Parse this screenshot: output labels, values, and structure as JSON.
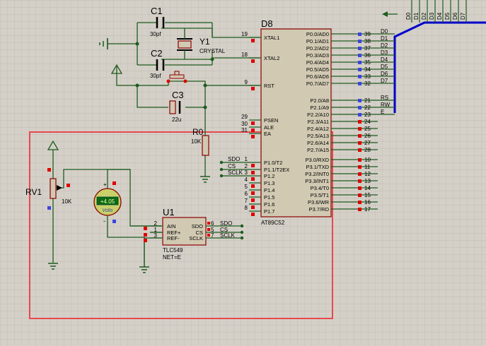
{
  "schematic": {
    "mcu": {
      "ref": "D8",
      "part": "AT89C52",
      "left_pins": [
        {
          "num": "19",
          "name": "XTAL1"
        },
        {
          "num": "18",
          "name": "XTAL2"
        },
        {
          "num": "9",
          "name": "RST"
        },
        {
          "num": "29",
          "name": "PSEN"
        },
        {
          "num": "30",
          "name": "ALE"
        },
        {
          "num": "31",
          "name": "EA"
        },
        {
          "num": "1",
          "name": "P1.0/T2"
        },
        {
          "num": "2",
          "name": "P1.1/T2EX"
        },
        {
          "num": "3",
          "name": "P1.2"
        },
        {
          "num": "4",
          "name": "P1.3"
        },
        {
          "num": "5",
          "name": "P1.4"
        },
        {
          "num": "6",
          "name": "P1.5"
        },
        {
          "num": "7",
          "name": "P1.6"
        },
        {
          "num": "8",
          "name": "P1.7"
        }
      ],
      "right_pins": [
        {
          "num": "39",
          "name": "P0.0/AD0"
        },
        {
          "num": "38",
          "name": "P0.1/AD1"
        },
        {
          "num": "37",
          "name": "P0.2/AD2"
        },
        {
          "num": "36",
          "name": "P0.3/AD3"
        },
        {
          "num": "35",
          "name": "P0.4/AD4"
        },
        {
          "num": "34",
          "name": "P0.5/AD5"
        },
        {
          "num": "33",
          "name": "P0.6/AD6"
        },
        {
          "num": "32",
          "name": "P0.7/AD7"
        },
        {
          "num": "21",
          "name": "P2.0/A8"
        },
        {
          "num": "22",
          "name": "P2.1/A9"
        },
        {
          "num": "23",
          "name": "P2.2/A10"
        },
        {
          "num": "24",
          "name": "P2.3/A11"
        },
        {
          "num": "25",
          "name": "P2.4/A12"
        },
        {
          "num": "26",
          "name": "P2.5/A13"
        },
        {
          "num": "27",
          "name": "P2.6/A14"
        },
        {
          "num": "28",
          "name": "P2.7/A15"
        },
        {
          "num": "10",
          "name": "P3.0/RXD"
        },
        {
          "num": "11",
          "name": "P3.1/TXD"
        },
        {
          "num": "12",
          "name": "P3.2/INT0"
        },
        {
          "num": "13",
          "name": "P3.3/INT1"
        },
        {
          "num": "14",
          "name": "P3.4/T0"
        },
        {
          "num": "15",
          "name": "P3.5/T1"
        },
        {
          "num": "16",
          "name": "P3.6/WR"
        },
        {
          "num": "17",
          "name": "P3.7/RD"
        }
      ]
    },
    "bus_nets": [
      "D0",
      "D1",
      "D2",
      "D3",
      "D4",
      "D5",
      "D6",
      "D7"
    ],
    "ctrl_nets": [
      "RS",
      "RW",
      "E"
    ],
    "header_labels": [
      "D0",
      "D1",
      "D2",
      "D3",
      "D4",
      "D5",
      "D6",
      "D7"
    ],
    "p1_nets": [
      "SDO",
      "CS",
      "SCLK"
    ],
    "c1": {
      "ref": "C1",
      "value": "30pf"
    },
    "c2": {
      "ref": "C2",
      "value": "30pf"
    },
    "c3": {
      "ref": "C3",
      "value": "22u"
    },
    "crystal": {
      "ref": "Y1",
      "value": "CRYSTAL"
    },
    "r0": {
      "ref": "R0",
      "value": "10K"
    },
    "rv1": {
      "ref": "RV1",
      "value": "10K"
    },
    "voltmeter": {
      "reading": "+4.05",
      "unit": "Volts",
      "plus": "+",
      "minus": "-"
    },
    "adc": {
      "ref": "U1",
      "part": "TLC549",
      "attr": "NET=E",
      "left_pins": [
        {
          "num": "2",
          "name": "AIN"
        },
        {
          "num": "1",
          "name": "REF+"
        },
        {
          "num": "3",
          "name": "REF-"
        }
      ],
      "right_pins": [
        {
          "num": "6",
          "name": "SDO",
          "net": "SDO"
        },
        {
          "num": "5",
          "name": "CS",
          "net": "CS"
        },
        {
          "num": "7",
          "name": "SCLK",
          "net": "SCLK"
        }
      ]
    },
    "colors": {
      "background": "#d4d0c8",
      "grid": "#bcb8ae",
      "wire": "#1e5b1e",
      "component": "#8b0000",
      "body_fill": "#d1c9b2",
      "bus": "#0000cc",
      "selection": "#e8494d",
      "pin_marker_red": "#e00000",
      "pin_marker_blue": "#3c44e0",
      "meter_face": "#c8d06a",
      "meter_lcd": "#0a6a12"
    }
  }
}
